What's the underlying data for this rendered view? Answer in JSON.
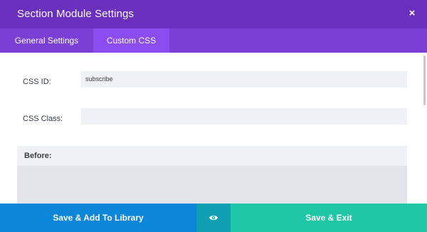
{
  "header": {
    "title": "Section Module Settings",
    "close_icon": "×"
  },
  "tabs": [
    {
      "label": "General Settings",
      "active": false
    },
    {
      "label": "Custom CSS",
      "active": true
    }
  ],
  "form": {
    "css_id": {
      "label": "CSS ID:",
      "value": "subscribe"
    },
    "css_class": {
      "label": "CSS Class:",
      "value": ""
    },
    "before": {
      "label": "Before:"
    }
  },
  "footer": {
    "save_library_label": "Save & Add To Library",
    "preview_icon": "eye-icon",
    "save_exit_label": "Save & Exit"
  },
  "colors": {
    "header": "#6a2fbd",
    "tabs": "#7b3fd6",
    "active_tab": "#8c4df0",
    "save_library": "#0c86d8",
    "preview": "#0e9fb3",
    "save_exit": "#1fc7a6"
  }
}
